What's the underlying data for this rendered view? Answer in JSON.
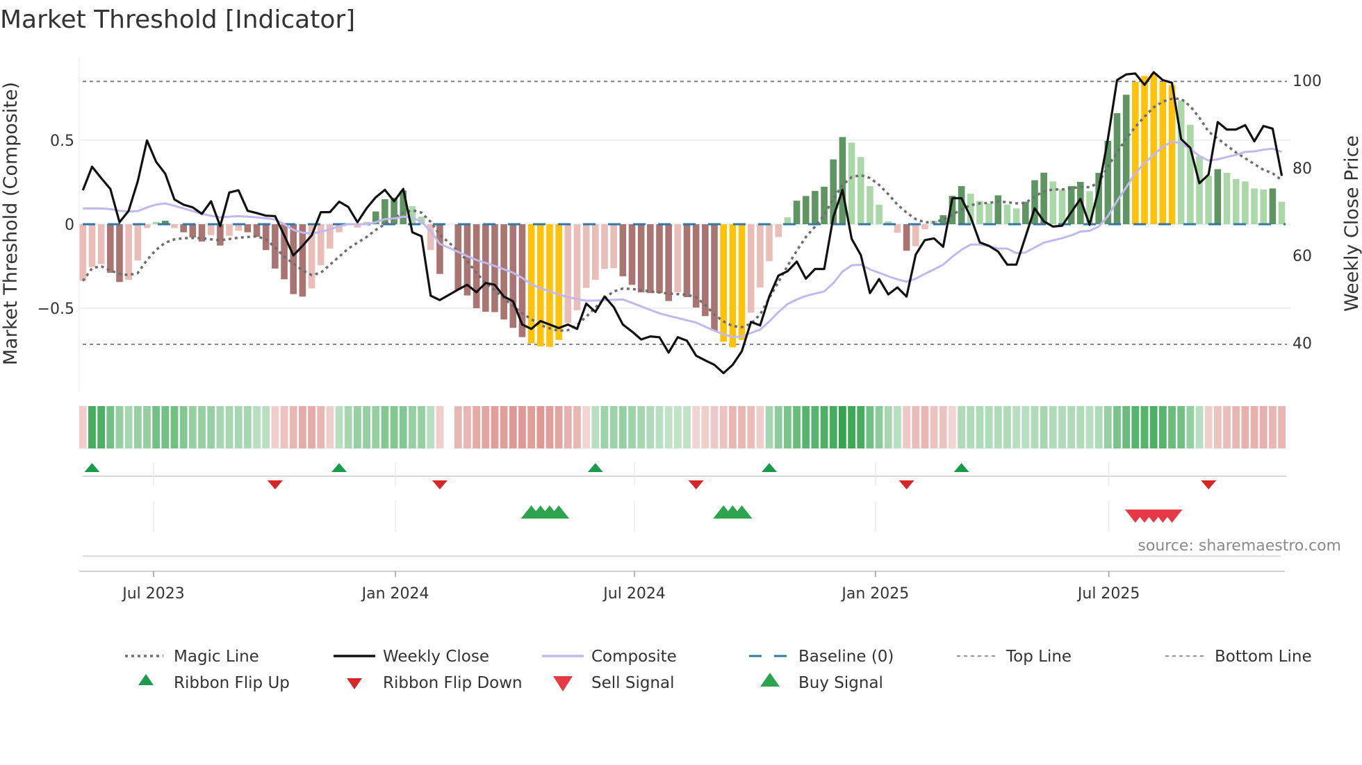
{
  "title": "Market Threshold [Indicator]",
  "source": "source: sharemaestro.com",
  "colors": {
    "dark_red": "#a97572",
    "light_red": "#e9bdb8",
    "dark_green": "#5f9562",
    "light_green": "#acd8a9",
    "yellow": "#ffc20a",
    "baseline": "#2f78a8",
    "composite": "#c3b8ee",
    "magic": "#6e6e6e",
    "close": "#111111",
    "ribbon_green": "#34a44e",
    "ribbon_red": "#d4756f",
    "flip_up": "#1a9a4a",
    "flip_down": "#d62728",
    "buy": "#2ea44f",
    "sell": "#e63946"
  },
  "chart_data": {
    "type": "bar+line",
    "title": "Market Threshold [Indicator]",
    "ylabel_left": "Market Threshold (Composite)",
    "ylabel_right": "Weekly Close Price",
    "ylim_left": [
      -0.98,
      1.0
    ],
    "ylim_right": [
      26,
      106
    ],
    "left_ticks": [
      {
        "value": 0.5,
        "label": "0.5"
      },
      {
        "value": 0,
        "label": "0"
      },
      {
        "value": -0.5,
        "label": "−0.5"
      }
    ],
    "right_ticks": [
      {
        "value": 100,
        "label": "100"
      },
      {
        "value": 80,
        "label": "80"
      },
      {
        "value": 60,
        "label": "60"
      },
      {
        "value": 40,
        "label": "40"
      }
    ],
    "x_ticks": [
      {
        "label": "Jul 2023",
        "week": 8.72
      },
      {
        "label": "Jan 2024",
        "week": 35.15
      },
      {
        "label": "Jul 2024",
        "week": 61.27
      },
      {
        "label": "Jan 2025",
        "week": 87.6
      },
      {
        "label": "Jul 2025",
        "week": 113.1
      }
    ],
    "top_line": 0.85,
    "bottom_line": -0.715,
    "baseline": 0,
    "bar_class_legend": {
      "D": "bearish strong",
      "L": "bearish weak",
      "G": "bullish strong",
      "g": "bullish weak",
      "Y": "extreme"
    },
    "bar_class": "LLLDDLLLgGLDDDLDLLDDDDDDDLLLLgLgGGGGggLDLDDDDDDDDYYYYLLLLLLDDDDDDLDDDDYYYLLLLgGGGGGGgggggLDLLgGGGgggGggGGGggGGgGGGGYYYYYggggGgggggGg",
    "composite_bars": [
      -0.337,
      -0.255,
      -0.237,
      -0.289,
      -0.344,
      -0.331,
      -0.216,
      -0.023,
      0.014,
      0.021,
      -0.023,
      -0.048,
      -0.079,
      -0.103,
      -0.065,
      -0.127,
      -0.069,
      -0.039,
      -0.048,
      -0.076,
      -0.154,
      -0.264,
      -0.328,
      -0.416,
      -0.431,
      -0.382,
      -0.244,
      -0.145,
      -0.048,
      0.007,
      -0.021,
      0.014,
      0.076,
      0.149,
      0.158,
      0.2,
      0.107,
      0.045,
      -0.154,
      -0.296,
      0,
      -0.39,
      -0.424,
      -0.5,
      -0.521,
      -0.523,
      -0.567,
      -0.617,
      -0.672,
      -0.709,
      -0.727,
      -0.73,
      -0.689,
      -0.588,
      -0.512,
      -0.379,
      -0.331,
      -0.266,
      -0.262,
      -0.31,
      -0.361,
      -0.406,
      -0.41,
      -0.41,
      -0.457,
      -0.406,
      -0.434,
      -0.496,
      -0.547,
      -0.634,
      -0.7,
      -0.733,
      -0.689,
      -0.526,
      -0.376,
      -0.22,
      -0.076,
      0.041,
      0.14,
      0.168,
      0.198,
      0.223,
      0.386,
      0.519,
      0.486,
      0.4,
      0.227,
      0.116,
      0.017,
      -0.051,
      -0.158,
      -0.131,
      -0.03,
      0.021,
      0.054,
      0.169,
      0.227,
      0.182,
      0.138,
      0.124,
      0.172,
      0.117,
      0.094,
      0.134,
      0.262,
      0.307,
      0.255,
      0.207,
      0.227,
      0.252,
      0.197,
      0.306,
      0.496,
      0.661,
      0.771,
      0.847,
      0.882,
      0.899,
      0.847,
      0.829,
      0.737,
      0.592,
      0.406,
      0.289,
      0.328,
      0.306,
      0.269,
      0.255,
      0.213,
      0.207,
      0.213,
      0.134
    ],
    "composite_line": [
      0.094,
      0.094,
      0.094,
      0.09,
      0.08,
      0.076,
      0.078,
      0.1,
      0.117,
      0.124,
      0.11,
      0.094,
      0.078,
      0.062,
      0.05,
      0.041,
      0.045,
      0.048,
      0.045,
      0.041,
      0.035,
      0.028,
      0.0,
      -0.034,
      -0.05,
      -0.055,
      -0.045,
      -0.03,
      -0.012,
      0.0,
      0.0,
      0.0,
      0.012,
      0.03,
      0.034,
      0.045,
      0.04,
      0.014,
      -0.041,
      -0.117,
      -0.14,
      -0.165,
      -0.19,
      -0.213,
      -0.23,
      -0.248,
      -0.268,
      -0.289,
      -0.32,
      -0.358,
      -0.38,
      -0.4,
      -0.418,
      -0.434,
      -0.446,
      -0.455,
      -0.454,
      -0.452,
      -0.45,
      -0.448,
      -0.468,
      -0.489,
      -0.51,
      -0.53,
      -0.545,
      -0.558,
      -0.572,
      -0.585,
      -0.61,
      -0.634,
      -0.655,
      -0.672,
      -0.668,
      -0.647,
      -0.627,
      -0.579,
      -0.523,
      -0.475,
      -0.448,
      -0.427,
      -0.413,
      -0.4,
      -0.351,
      -0.282,
      -0.245,
      -0.241,
      -0.269,
      -0.289,
      -0.31,
      -0.328,
      -0.342,
      -0.324,
      -0.296,
      -0.269,
      -0.241,
      -0.193,
      -0.152,
      -0.121,
      -0.121,
      -0.131,
      -0.145,
      -0.145,
      -0.172,
      -0.168,
      -0.138,
      -0.11,
      -0.096,
      -0.083,
      -0.066,
      -0.044,
      -0.039,
      -0.014,
      0.048,
      0.138,
      0.22,
      0.303,
      0.365,
      0.413,
      0.461,
      0.492,
      0.482,
      0.448,
      0.406,
      0.379,
      0.386,
      0.4,
      0.413,
      0.43,
      0.434,
      0.444,
      0.45,
      0.43
    ],
    "magic_line": [
      -0.337,
      -0.262,
      -0.25,
      -0.275,
      -0.296,
      -0.303,
      -0.29,
      -0.213,
      -0.152,
      -0.11,
      -0.09,
      -0.083,
      -0.082,
      -0.083,
      -0.09,
      -0.096,
      -0.088,
      -0.08,
      -0.076,
      -0.072,
      -0.09,
      -0.138,
      -0.193,
      -0.234,
      -0.275,
      -0.303,
      -0.289,
      -0.241,
      -0.193,
      -0.145,
      -0.11,
      -0.076,
      -0.034,
      0.0,
      0.034,
      0.069,
      0.083,
      0.069,
      0.014,
      -0.062,
      -0.11,
      -0.158,
      -0.22,
      -0.289,
      -0.351,
      -0.393,
      -0.44,
      -0.489,
      -0.53,
      -0.565,
      -0.6,
      -0.62,
      -0.634,
      -0.631,
      -0.6,
      -0.551,
      -0.496,
      -0.44,
      -0.4,
      -0.383,
      -0.385,
      -0.393,
      -0.4,
      -0.406,
      -0.413,
      -0.416,
      -0.42,
      -0.434,
      -0.482,
      -0.537,
      -0.579,
      -0.606,
      -0.613,
      -0.592,
      -0.537,
      -0.44,
      -0.344,
      -0.248,
      -0.158,
      -0.076,
      -0.014,
      0.055,
      0.152,
      0.234,
      0.28,
      0.292,
      0.275,
      0.234,
      0.179,
      0.117,
      0.069,
      0.03,
      0.011,
      0.011,
      0.028,
      0.055,
      0.09,
      0.113,
      0.124,
      0.127,
      0.135,
      0.131,
      0.124,
      0.127,
      0.165,
      0.196,
      0.207,
      0.207,
      0.213,
      0.223,
      0.22,
      0.248,
      0.344,
      0.427,
      0.51,
      0.579,
      0.64,
      0.696,
      0.73,
      0.747,
      0.747,
      0.702,
      0.634,
      0.551,
      0.51,
      0.468,
      0.427,
      0.393,
      0.358,
      0.324,
      0.303,
      0.262
    ],
    "weekly_close": [
      74.9,
      80.3,
      77.7,
      75.2,
      67.6,
      70.2,
      77.0,
      86.3,
      81.4,
      78.7,
      72.8,
      71.6,
      71.0,
      69.5,
      72.4,
      66.7,
      74.4,
      74.9,
      70.2,
      69.7,
      69.1,
      69.0,
      64.6,
      60.0,
      62.2,
      64.6,
      69.9,
      69.9,
      72.3,
      71.1,
      67.6,
      70.8,
      73.3,
      75.0,
      72.4,
      75.2,
      65.3,
      64.4,
      50.8,
      49.8,
      51.0,
      52.2,
      53.3,
      51.6,
      53.7,
      53.3,
      50.6,
      49.5,
      44.2,
      43.2,
      45.0,
      44.2,
      43.4,
      44.2,
      43.2,
      49.0,
      47.1,
      50.6,
      48.2,
      44.2,
      42.6,
      40.8,
      41.5,
      41.3,
      37.8,
      41.3,
      40.5,
      37.1,
      36.0,
      35.0,
      33.1,
      35.0,
      38.1,
      44.8,
      44.0,
      50.6,
      55.4,
      56.4,
      58.6,
      54.7,
      56.9,
      56.9,
      68.8,
      75.0,
      63.8,
      60.1,
      51.4,
      54.6,
      51.1,
      52.7,
      50.6,
      60.2,
      63.5,
      63.9,
      62.0,
      73.1,
      73.1,
      68.8,
      63.0,
      62.2,
      60.9,
      57.9,
      57.9,
      64.3,
      70.8,
      67.8,
      66.6,
      66.8,
      69.9,
      72.9,
      67.0,
      75.2,
      86.6,
      100.1,
      101.4,
      101.6,
      99.0,
      101.9,
      100.1,
      99.5,
      86.6,
      84.6,
      76.5,
      78.5,
      90.5,
      88.8,
      88.8,
      89.8,
      86.1,
      89.6,
      89.0,
      78.2
    ],
    "ribbon": [
      -0.2,
      0.85,
      0.8,
      0.6,
      0.4,
      0.3,
      0.4,
      0.4,
      0.6,
      0.6,
      0.6,
      0.5,
      0.4,
      0.4,
      0.4,
      0.3,
      0.3,
      0.3,
      0.3,
      0.2,
      0.2,
      -0.2,
      -0.3,
      -0.4,
      -0.5,
      -0.5,
      -0.4,
      -0.2,
      0.2,
      0.3,
      0.4,
      0.4,
      0.4,
      0.5,
      0.5,
      0.5,
      0.4,
      0.4,
      0.2,
      -0.2,
      0,
      -0.4,
      -0.4,
      -0.5,
      -0.55,
      -0.6,
      -0.6,
      -0.65,
      -0.65,
      -0.6,
      -0.65,
      -0.6,
      -0.55,
      -0.45,
      -0.4,
      -0.15,
      0.2,
      0.35,
      0.35,
      0.4,
      0.35,
      0.3,
      0.25,
      0.2,
      0.15,
      0.15,
      0.15,
      -0.15,
      -0.2,
      -0.25,
      -0.3,
      -0.4,
      -0.4,
      -0.35,
      -0.2,
      0.3,
      0.45,
      0.55,
      0.65,
      0.75,
      0.75,
      0.8,
      0.85,
      0.95,
      0.9,
      0.85,
      0.6,
      0.45,
      0.3,
      0.2,
      -0.25,
      -0.35,
      -0.4,
      -0.3,
      -0.3,
      -0.15,
      0.25,
      0.25,
      0.25,
      0.25,
      0.25,
      0.25,
      0.2,
      0.2,
      0.25,
      0.3,
      0.25,
      0.25,
      0.25,
      0.25,
      0.2,
      0.25,
      0.4,
      0.55,
      0.65,
      0.75,
      0.75,
      0.8,
      0.75,
      0.65,
      0.6,
      0.4,
      0.2,
      -0.2,
      -0.3,
      -0.35,
      -0.4,
      -0.45,
      -0.45,
      -0.45,
      -0.4,
      -0.4
    ],
    "ribbon_flip_up_weeks": [
      2,
      29,
      57,
      76,
      97
    ],
    "ribbon_flip_down_weeks": [
      22,
      40,
      68,
      91,
      124
    ],
    "buy_signal_weeks": [
      50,
      51,
      52,
      53,
      71,
      72,
      73
    ],
    "sell_signal_weeks": [
      116,
      117,
      118,
      119,
      120
    ],
    "legend": [
      {
        "label": "Magic Line",
        "symbol": "dotted-line"
      },
      {
        "label": "Weekly Close",
        "symbol": "solid-black-line"
      },
      {
        "label": "Composite",
        "symbol": "lavender-line"
      },
      {
        "label": "Baseline (0)",
        "symbol": "blue-dashed-line"
      },
      {
        "label": "Top Line",
        "symbol": "gray-dashed-line"
      },
      {
        "label": "Bottom Line",
        "symbol": "gray-dashed-line"
      },
      {
        "label": "Ribbon Flip Up",
        "symbol": "triangle-up"
      },
      {
        "label": "Ribbon Flip Down",
        "symbol": "triangle-down"
      },
      {
        "label": "Sell Signal",
        "symbol": "triangle-down"
      },
      {
        "label": "Buy Signal",
        "symbol": "triangle-up"
      }
    ],
    "legend_placement": "bottom"
  }
}
